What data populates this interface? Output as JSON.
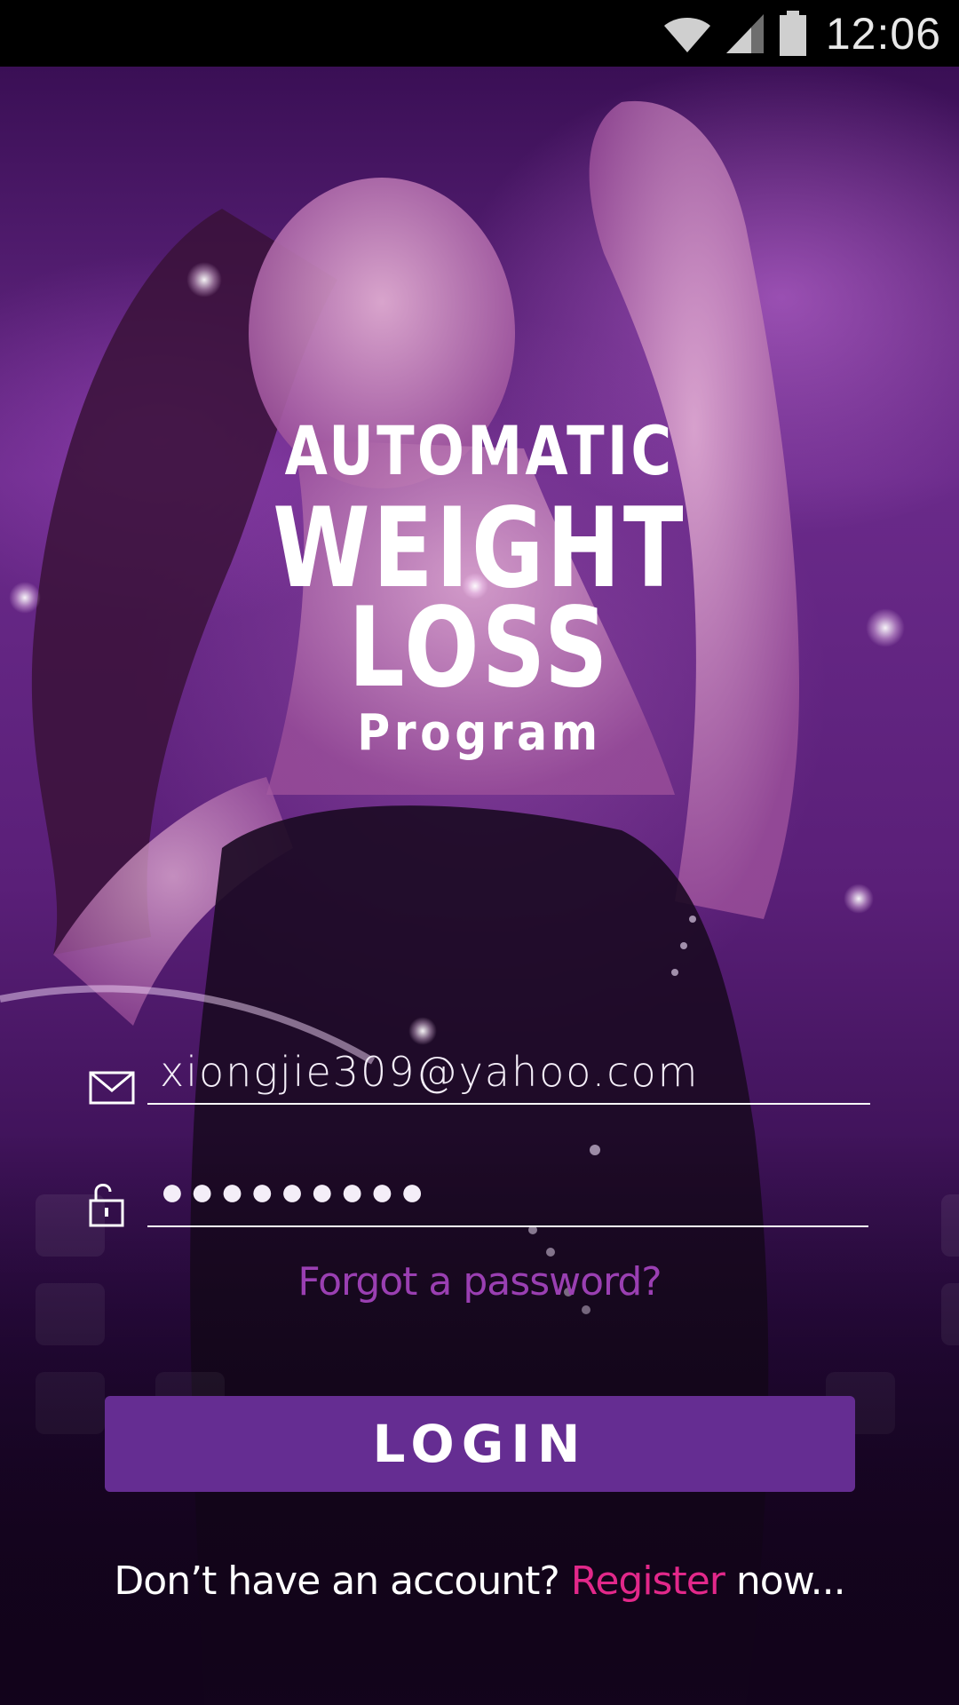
{
  "status_bar": {
    "time": "12:06",
    "icons": [
      "wifi-icon",
      "cellular-signal-icon",
      "battery-icon"
    ]
  },
  "logo": {
    "line1": "AUTOMATIC",
    "line2": "WEIGHT",
    "line3": "LOSS",
    "line4": "Program"
  },
  "form": {
    "email": {
      "icon": "envelope-icon",
      "value": "xiongjie309@yahoo.com"
    },
    "password": {
      "icon": "unlocked-padlock-icon",
      "value": "●●●●●●●●●"
    },
    "forgot_label": "Forgot a password?",
    "login_label": "LOGIN"
  },
  "footer": {
    "prefix": "Don’t have an account?",
    "register_label": "Register",
    "suffix": "now..."
  },
  "colors": {
    "accent": "#652d92",
    "forgot_link": "#9a3fb2",
    "register_link": "#e2288a",
    "status_bar": "#000000"
  }
}
